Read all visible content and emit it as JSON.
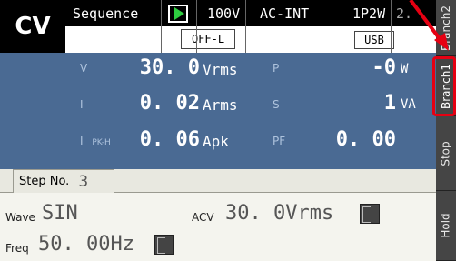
{
  "header": {
    "mode": "CV",
    "function": "Sequence",
    "voltage_range": "100V",
    "source_mode": "AC-INT",
    "wiring": "1P2W",
    "extra": "2.",
    "output_state": "OFF-L",
    "interface": "USB"
  },
  "measurements": {
    "v_label": "V",
    "v_value": "30. 0",
    "v_unit": "Vrms",
    "i_label": "I",
    "i_value": "0. 02",
    "i_unit": "Arms",
    "ipk_label": "I",
    "ipk_sub": "PK-H",
    "ipk_value": "0. 06",
    "ipk_unit": "Apk",
    "p_label": "P",
    "p_value": "-0",
    "p_unit": "W",
    "s_label": "S",
    "s_value": "1",
    "s_unit": "VA",
    "pf_label": "PF",
    "pf_value": "0. 00"
  },
  "step": {
    "tab_label": "Step No.",
    "number": "3",
    "wave_label": "Wave",
    "wave_value": "SIN",
    "acv_label": "ACV",
    "acv_value": "30. 0Vrms",
    "freq_label": "Freq",
    "freq_value": "50. 00Hz"
  },
  "softkeys": {
    "top": "Branch2",
    "branch1": "Branch1",
    "stop": "Stop",
    "hold": "Hold"
  },
  "colors": {
    "panel_blue": "#4a6a93",
    "highlight_red": "#e60012"
  }
}
